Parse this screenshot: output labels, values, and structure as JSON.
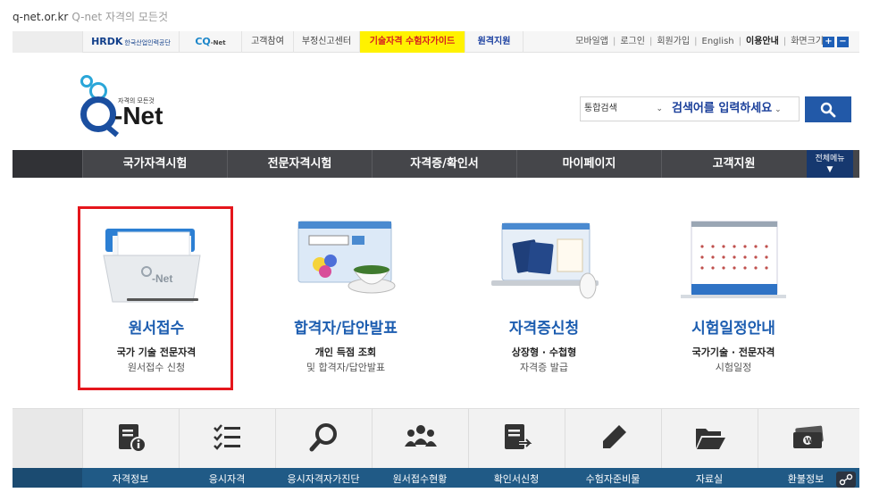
{
  "browser": {
    "url": "q-net.or.kr",
    "page_title": "Q-net 자격의 모든것"
  },
  "topbar": {
    "hrdk": "HRDK",
    "hrdk_sub": "한국산업인력공단",
    "cqnet": "CQ",
    "cqnet_suffix": "-Net",
    "customer": "고객참여",
    "report": "부정신고센터",
    "guide": "기술자격 수험자가이드",
    "remote": "원격지원",
    "util": {
      "mobile": "모바일앱",
      "login": "로그인",
      "join": "회원가입",
      "english": "English",
      "usage": "이용안내",
      "fontsize": "화면크기"
    },
    "zoom_in": "+",
    "zoom_out": "−"
  },
  "logo": {
    "tagline": "자격의 모든것",
    "name": "-Net"
  },
  "search": {
    "scope": "통합검색",
    "placeholder": "검색어를 입력하세요"
  },
  "mainnav": {
    "items": [
      "국가자격시험",
      "전문자격시험",
      "자격증/확인서",
      "마이페이지",
      "고객지원"
    ],
    "all_menu": "전체메뉴"
  },
  "cards": [
    {
      "title": "원서접수",
      "line1": "국가 기술 전문자격",
      "line2": "원서접수 신청",
      "icon": "folder-icon"
    },
    {
      "title": "합격자/답안발표",
      "line1": "개인 득점 조회",
      "line2": "및 합격자/답안발표",
      "icon": "monitor-teacup-icon"
    },
    {
      "title": "자격증신청",
      "line1": "상장형 · 수첩형",
      "line2": "자격증 발급",
      "icon": "monitor-passport-icon"
    },
    {
      "title": "시험일정안내",
      "line1": "국가기술 · 전문자격",
      "line2": "시험일정",
      "icon": "calendar-icon"
    }
  ],
  "quick": {
    "items": [
      "자격정보",
      "응시자격",
      "응시자격자가진단",
      "원서접수현황",
      "확인서신청",
      "수험자준비물",
      "자료실",
      "환불정보"
    ]
  },
  "colors": {
    "accent": "#1c5db0",
    "highlight": "#e5161c",
    "nav": "#45464a",
    "quick_bar": "#205a86"
  }
}
